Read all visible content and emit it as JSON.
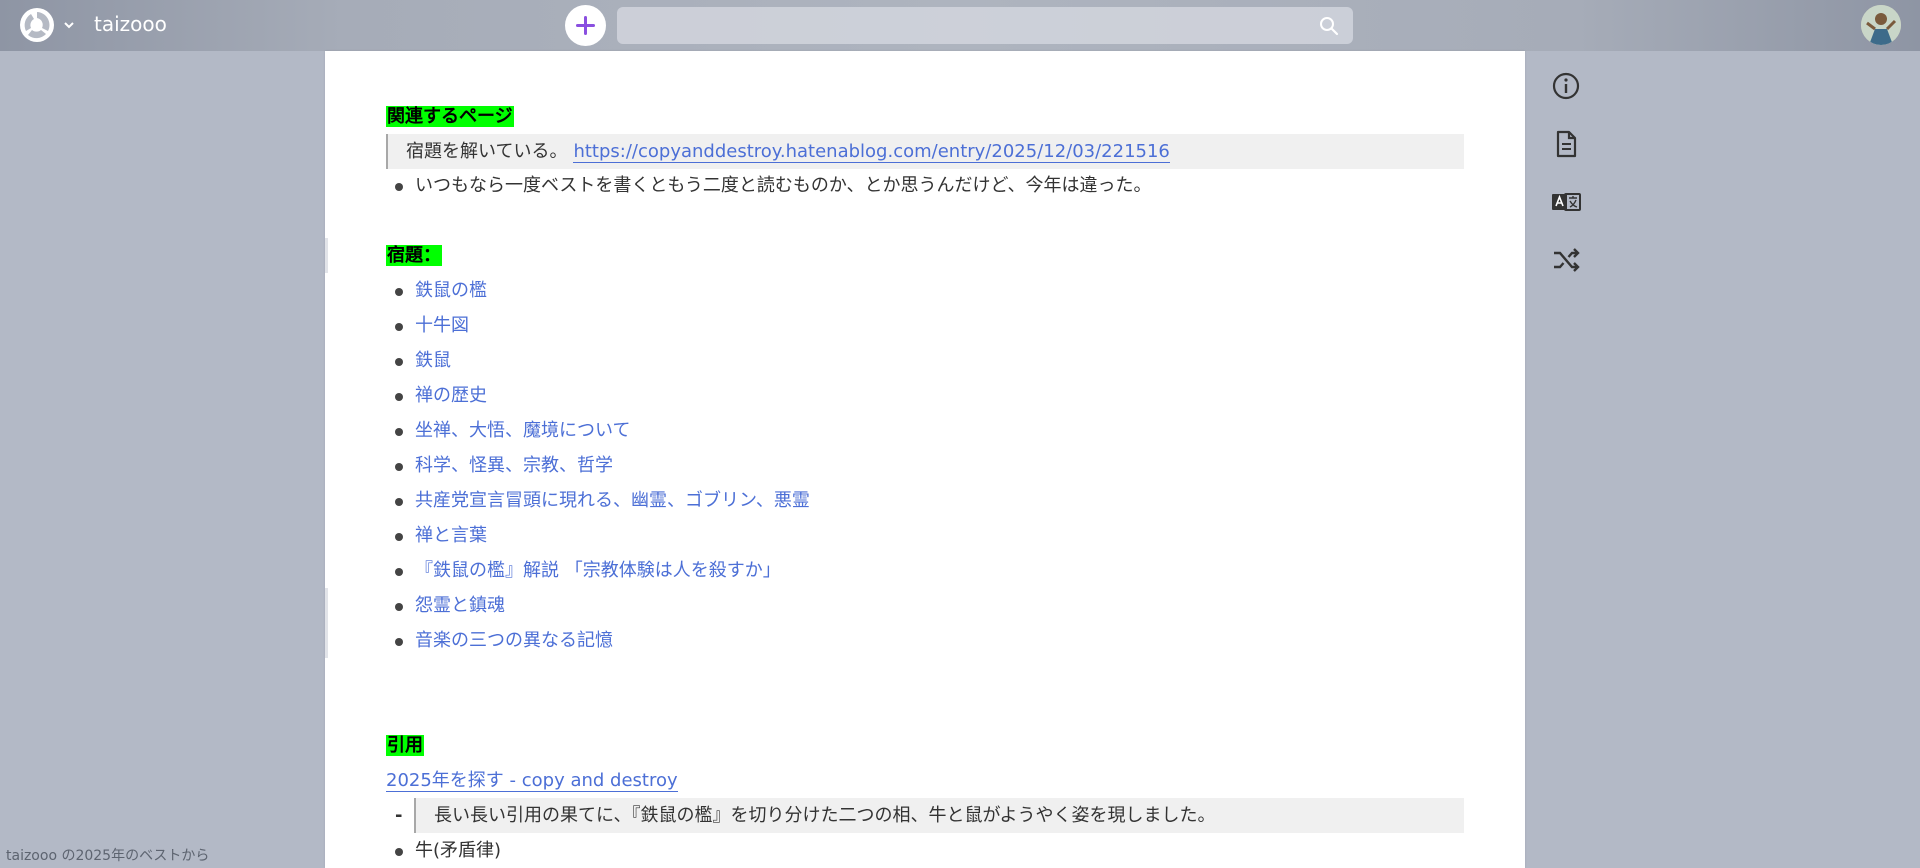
{
  "header": {
    "project_name": "taizooo",
    "search_placeholder": "",
    "icons": {
      "logo": "scrapbox-logo-icon",
      "chevron": "chevron-down-icon",
      "new_page": "plus-icon",
      "search": "search-icon",
      "avatar": "user-avatar"
    }
  },
  "page": {
    "related_heading": "関連するページ",
    "related_quote_text": "宿題を解いている。",
    "related_quote_link": "https://copyanddestroy.hatenablog.com/entry/2025/12/03/221516",
    "related_note": "いつもなら一度ベストを書くともう二度と読むものか、とか思うんだけど、今年は違った。",
    "homework_heading": "宿題：",
    "homework_items": [
      "鉄鼠の檻",
      "十牛図",
      "鉄鼠",
      "禅の歴史",
      "坐禅、大悟、魔境について",
      "科学、怪異、宗教、哲学",
      "共産党宣言冒頭に現れる、幽霊、ゴブリン、悪霊",
      "禅と言葉",
      "『鉄鼠の檻』解説 「宗教体験は人を殺すか」",
      "怨霊と鎮魂",
      "音楽の三つの異なる記憶"
    ],
    "citation_heading": "引用",
    "citation_link": "2025年を探す - copy and destroy",
    "citation_dash": "-",
    "citation_quote": "長い長い引用の果てに、『鉄鼠の檻』を切り分けた二つの相、牛と鼠がようやく姿を現しました。",
    "citation_next_item": "牛(矛盾律)"
  },
  "sidebar": {
    "icons": [
      "info-icon",
      "document-icon",
      "translate-icon",
      "shuffle-icon"
    ]
  },
  "footer": {
    "text": "taizooo の2025年のベストから"
  },
  "colors": {
    "highlight": "#00ff00",
    "link": "#4c6fd6",
    "accent_plus": "#8a4fe0"
  }
}
